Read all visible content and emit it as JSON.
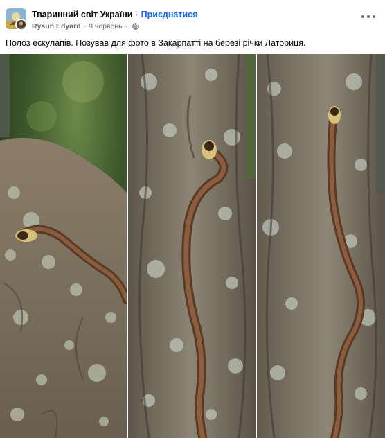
{
  "post": {
    "group_name": "Тваринний світ України",
    "separator": "·",
    "join_label": "Приєднатися",
    "author_name": "Rysun Edyard",
    "date": "9 червень",
    "text": "Полоз ескулапів. Позував для фото в Закарпатті на березі річки Латориця.",
    "icons": {
      "group_avatar": "group-avatar-icon",
      "privacy": "globe-icon",
      "more": "more-options-icon"
    }
  },
  "photos": [
    {
      "name": "photo-snake-on-log",
      "description_visible": ""
    },
    {
      "name": "photo-snake-on-trunk-middle",
      "description_visible": ""
    },
    {
      "name": "photo-snake-on-trunk-right",
      "description_visible": ""
    }
  ],
  "colors": {
    "accent": "#0866ff",
    "secondary_text": "#65676b",
    "primary_text": "#050505"
  }
}
